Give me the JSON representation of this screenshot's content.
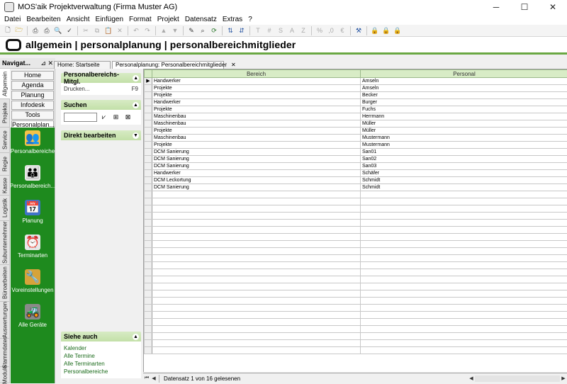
{
  "window": {
    "title": "MOS'aik Projektverwaltung (Firma Muster AG)"
  },
  "menu": [
    "Datei",
    "Bearbeiten",
    "Ansicht",
    "Einfügen",
    "Format",
    "Projekt",
    "Datensatz",
    "Extras",
    "?"
  ],
  "header": {
    "path": "allgemein | personalplanung | personalbereichmitglieder"
  },
  "nav": {
    "title": "Navigat...",
    "buttons": [
      "Home",
      "Agenda",
      "Planung",
      "Infodesk",
      "Tools",
      "Personalplan..."
    ],
    "vtabs": [
      "Allgemein",
      "Projekte",
      "Service",
      "Regie",
      "Kasse",
      "Logistik",
      "Subunternehmer",
      "Büroarbeiten",
      "Auswertungen",
      "Stammdaten",
      "Module"
    ],
    "icons": [
      {
        "label": "Personalbereiche",
        "icon": "people-icon"
      },
      {
        "label": "Personalbereich...",
        "icon": "people-group-icon"
      },
      {
        "label": "Planung",
        "icon": "calendar-icon"
      },
      {
        "label": "Terminarten",
        "icon": "clock-icon"
      },
      {
        "label": "Voreinstellungen",
        "icon": "wrench-icon"
      },
      {
        "label": "Alle Geräte",
        "icon": "devices-icon"
      }
    ]
  },
  "tabs": [
    {
      "label": "Home: Startseite"
    },
    {
      "label": "Personalplanung: Personalbereichmitglieder"
    }
  ],
  "taskpane": {
    "section1": {
      "title": "Personalbereichs-Mitgl.",
      "action": "Drucken...",
      "shortcut": "F9"
    },
    "section2": {
      "title": "Suchen"
    },
    "section3": {
      "title": "Direkt bearbeiten"
    },
    "section4": {
      "title": "Siehe auch",
      "links": [
        "Kalender",
        "Alle Termine",
        "Alle Terminarten",
        "Personalbereiche"
      ]
    }
  },
  "grid": {
    "columns": [
      "Bereich",
      "Personal"
    ],
    "rows": [
      [
        "Handwerker",
        "Amseln"
      ],
      [
        "Projekte",
        "Amseln"
      ],
      [
        "Projekte",
        "Becker"
      ],
      [
        "Handwerker",
        "Burger"
      ],
      [
        "Projekte",
        "Fuchs"
      ],
      [
        "Maschinenbau",
        "Herrmann"
      ],
      [
        "Maschinenbau",
        "Müller"
      ],
      [
        "Projekte",
        "Müller"
      ],
      [
        "Maschinenbau",
        "Mustermann"
      ],
      [
        "Projekte",
        "Mustermann"
      ],
      [
        "DCM Sanierung",
        "San01"
      ],
      [
        "DCM Sanierung",
        "San02"
      ],
      [
        "DCM Sanierung",
        "San03"
      ],
      [
        "Handwerker",
        "Schäfer"
      ],
      [
        "DCM Leckortung",
        "Schmidt"
      ],
      [
        "DCM Sanierung",
        "Schmidt"
      ]
    ],
    "empty_rows": 23
  },
  "status": {
    "text": "Datensatz 1 von 16 gelesenen"
  },
  "colors": {
    "accent": "#6aa843",
    "nav_green": "#1e8a1e",
    "header_green": "#d8ecc6"
  }
}
